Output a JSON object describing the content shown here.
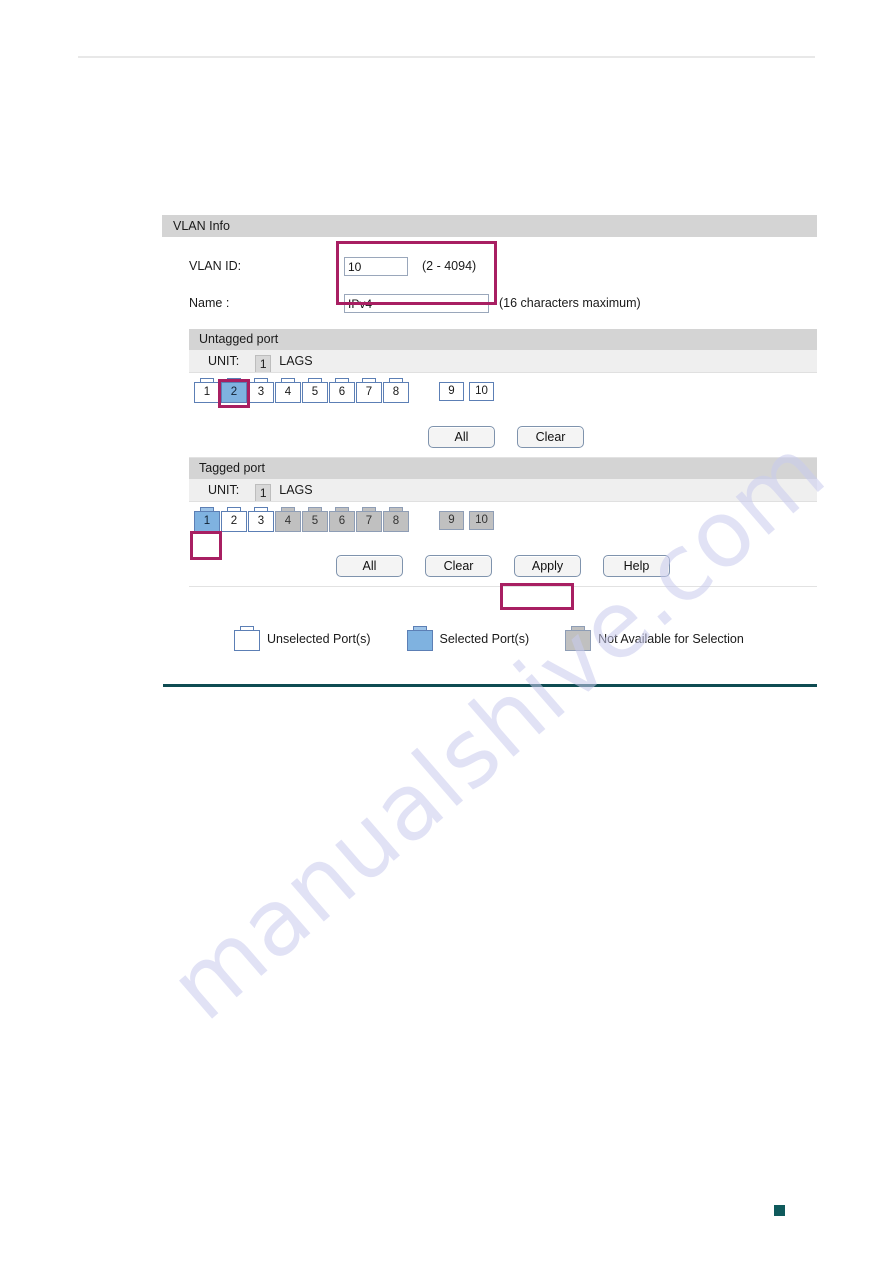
{
  "page": {
    "corner_marker_color": "#0f5a5c",
    "accent_rule_color": "#0f4c52",
    "highlight_color": "#a81f62",
    "watermark_text": "manualshive.com"
  },
  "panel": {
    "title": "VLAN Info",
    "vlan_id": {
      "label": "VLAN ID:",
      "value": "10",
      "placeholder": "",
      "hint": "(2 - 4094)"
    },
    "name": {
      "label": "Name :",
      "value": "IPv4",
      "placeholder": "",
      "hint": "(16 characters maximum)"
    }
  },
  "untagged": {
    "title": "Untagged port",
    "unit_label": "UNIT:",
    "unit_value": "1",
    "lags_label": "LAGS",
    "ports": [
      {
        "num": "1",
        "state": "unselected",
        "type": "rj45"
      },
      {
        "num": "2",
        "state": "selected",
        "type": "rj45"
      },
      {
        "num": "3",
        "state": "unselected",
        "type": "rj45"
      },
      {
        "num": "4",
        "state": "unselected",
        "type": "rj45"
      },
      {
        "num": "5",
        "state": "unselected",
        "type": "rj45"
      },
      {
        "num": "6",
        "state": "unselected",
        "type": "rj45"
      },
      {
        "num": "7",
        "state": "unselected",
        "type": "rj45"
      },
      {
        "num": "8",
        "state": "unselected",
        "type": "rj45"
      }
    ],
    "sfp_ports": [
      {
        "num": "9",
        "state": "unselected",
        "type": "sfp"
      },
      {
        "num": "10",
        "state": "unselected",
        "type": "sfp"
      }
    ],
    "buttons": [
      {
        "label": "All"
      },
      {
        "label": "Clear"
      }
    ]
  },
  "tagged": {
    "title": "Tagged port",
    "unit_label": "UNIT:",
    "unit_value": "1",
    "lags_label": "LAGS",
    "ports": [
      {
        "num": "1",
        "state": "selected",
        "type": "rj45"
      },
      {
        "num": "2",
        "state": "unselected",
        "type": "rj45"
      },
      {
        "num": "3",
        "state": "unselected",
        "type": "rj45"
      },
      {
        "num": "4",
        "state": "na",
        "type": "rj45"
      },
      {
        "num": "5",
        "state": "na",
        "type": "rj45"
      },
      {
        "num": "6",
        "state": "na",
        "type": "rj45"
      },
      {
        "num": "7",
        "state": "na",
        "type": "rj45"
      },
      {
        "num": "8",
        "state": "na",
        "type": "rj45"
      }
    ],
    "sfp_ports": [
      {
        "num": "9",
        "state": "na",
        "type": "sfp"
      },
      {
        "num": "10",
        "state": "na",
        "type": "sfp"
      }
    ],
    "buttons": [
      {
        "label": "All"
      },
      {
        "label": "Clear"
      },
      {
        "label": "Apply"
      },
      {
        "label": "Help"
      }
    ]
  },
  "legend": [
    {
      "state": "unselected",
      "label": "Unselected Port(s)"
    },
    {
      "state": "selected",
      "label": "Selected Port(s)"
    },
    {
      "state": "na",
      "label": "Not Available for Selection"
    }
  ]
}
